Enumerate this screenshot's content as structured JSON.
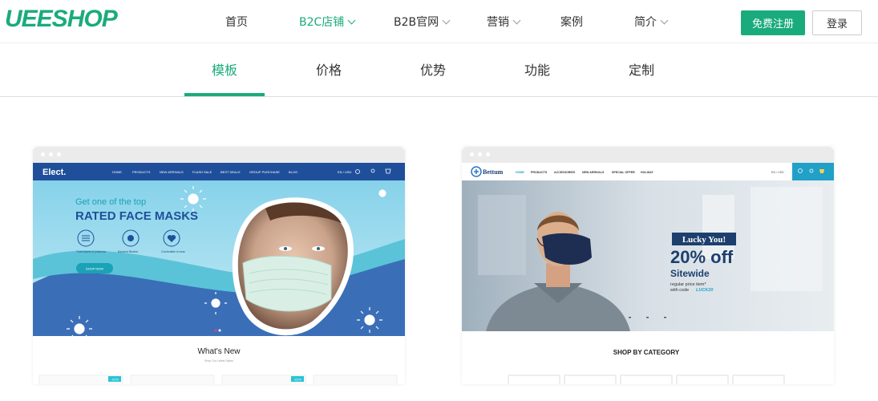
{
  "header": {
    "logo": "UEESHOP",
    "nav": [
      {
        "label": "首页"
      },
      {
        "label": "B2C店铺"
      },
      {
        "label": "B2B官网"
      },
      {
        "label": "营销"
      },
      {
        "label": "案例"
      },
      {
        "label": "简介"
      }
    ],
    "register_label": "免费注册",
    "login_label": "登录"
  },
  "tabs": [
    "模板",
    "价格",
    "优势",
    "功能",
    "定制"
  ],
  "colors": {
    "accent": "#1aab7c"
  },
  "templates": {
    "elect": {
      "logo": "Elect.",
      "nav": [
        "HOME",
        "PRODUCTS",
        "NEW ARRIVALS",
        "FLASH SALE",
        "BEST DEALS",
        "GROUP PURCHASE",
        "BLOG"
      ],
      "lang": "EN / USD",
      "headline_1": "Get one of the top",
      "headline_2": "RATED FACE MASKS",
      "features": [
        "Three layers of protection",
        "Bacterial filtration",
        "Comfortable to wear"
      ],
      "cta": "SHOP NOW",
      "section_title": "What's New",
      "section_sub": "Shop Our Latest Styles",
      "badge": "-21%"
    },
    "bettum": {
      "logo": "Bettum",
      "nav": [
        "HOME",
        "PRODUCTS",
        "ACCESSORIES",
        "NEW ARRIVALS",
        "SPECIAL OFFER",
        "HOLIDAY"
      ],
      "lang": "EN / USD",
      "promo_1": "Lucky You!",
      "promo_2": "20% off",
      "promo_3": "Sitewide",
      "promo_4": "regular price item*",
      "promo_5": "with code",
      "code": "LUCK20",
      "section_title": "SHOP BY CATEGORY"
    }
  }
}
